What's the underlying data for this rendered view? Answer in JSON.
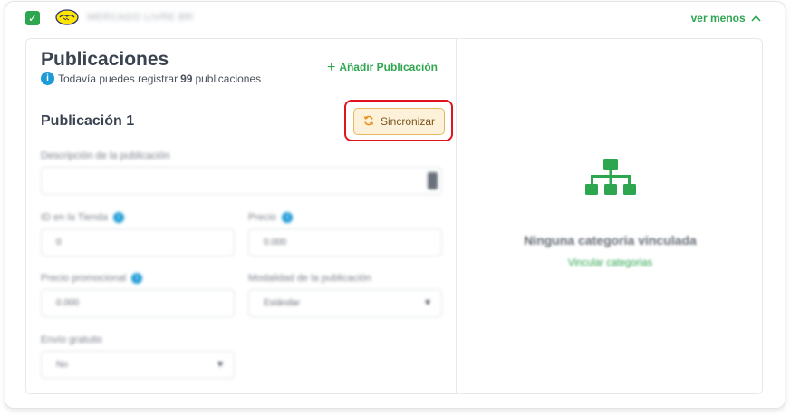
{
  "account": {
    "name": "MERCADO LIVRE BR",
    "toggle_label": "ver menos",
    "toggle_icon": "chevron-up-icon"
  },
  "publications": {
    "title": "Publicaciones",
    "subtitle_prefix": "Todavía puedes registrar ",
    "remaining": "99",
    "subtitle_suffix": " publicaciones",
    "add_label": "Añadir Publicación"
  },
  "publication": {
    "title": "Publicación 1",
    "sync_label": "Sincronizar",
    "fields": {
      "description": {
        "label": "Descripción de la publicación",
        "value": ""
      },
      "store_id": {
        "label": "ID en la Tienda",
        "value": "0"
      },
      "price": {
        "label": "Precio",
        "value": "0.000"
      },
      "promo_price": {
        "label": "Precio promocional",
        "value": "0.000"
      },
      "mode": {
        "label": "Modalidad de la publicación",
        "value": "Estándar"
      },
      "free_shipping": {
        "label": "Envío gratuito",
        "value": "No"
      }
    }
  },
  "categories": {
    "empty_title": "Ninguna categoria vinculada",
    "link_label": "Vincular categorias"
  },
  "colors": {
    "accent_green": "#2ea650",
    "info_blue": "#1e9bd7",
    "highlight_red": "#e0141e",
    "sync_orange": "#e6901a"
  }
}
